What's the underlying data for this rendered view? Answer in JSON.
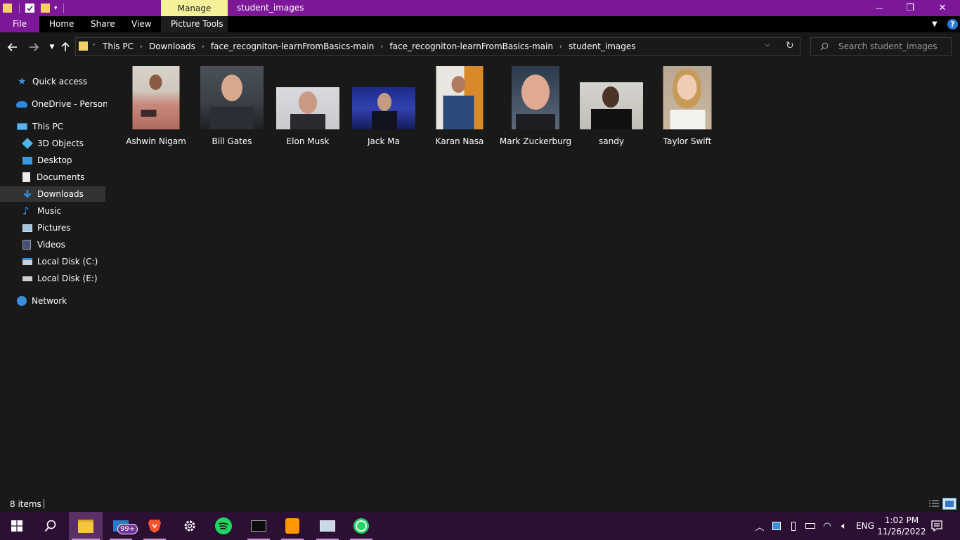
{
  "title_bar": {
    "manage_tab": "Manage",
    "window_title": "student_images",
    "minimize_glyph": "—",
    "maximize_glyph": "❐",
    "close_glyph": "✕"
  },
  "ribbon": {
    "tabs": [
      "File",
      "Home",
      "Share",
      "View",
      "Picture Tools"
    ],
    "help_glyph": "?"
  },
  "address_bar": {
    "breadcrumbs": [
      "This PC",
      "Downloads",
      "face_recogniton-learnFromBasics-main",
      "face_recogniton-learnFromBasics-main",
      "student_images"
    ],
    "search_placeholder": "Search student_images"
  },
  "nav_pane": {
    "items": [
      {
        "label": "Quick access",
        "icon": "star-icon"
      },
      {
        "label": "OneDrive - Personal",
        "icon": "cloud-icon"
      },
      {
        "label": "This PC",
        "icon": "computer-icon"
      },
      {
        "label": "3D Objects",
        "icon": "cube-icon"
      },
      {
        "label": "Desktop",
        "icon": "desktop-icon"
      },
      {
        "label": "Documents",
        "icon": "document-icon"
      },
      {
        "label": "Downloads",
        "icon": "download-icon",
        "selected": true
      },
      {
        "label": "Music",
        "icon": "music-icon"
      },
      {
        "label": "Pictures",
        "icon": "picture-icon"
      },
      {
        "label": "Videos",
        "icon": "video-icon"
      },
      {
        "label": "Local Disk (C:)",
        "icon": "disk-icon"
      },
      {
        "label": "Local Disk (E:)",
        "icon": "disk-icon"
      },
      {
        "label": "Network",
        "icon": "network-icon"
      }
    ]
  },
  "files": [
    {
      "name": "Ashwin Nigam"
    },
    {
      "name": "Bill Gates"
    },
    {
      "name": "Elon Musk"
    },
    {
      "name": "Jack Ma"
    },
    {
      "name": "Karan Nasa"
    },
    {
      "name": "Mark Zuckerburg"
    },
    {
      "name": "sandy"
    },
    {
      "name": "Taylor Swift"
    }
  ],
  "status_bar": {
    "item_count": "8 items"
  },
  "taskbar": {
    "mail_badge": "99+",
    "language": "ENG",
    "time": "1:02 PM",
    "date": "11/26/2022"
  },
  "colors": {
    "accent": "#7c1898",
    "manage_tab": "#f3f19a",
    "taskbar": "#2c1034",
    "background": "#191919"
  }
}
